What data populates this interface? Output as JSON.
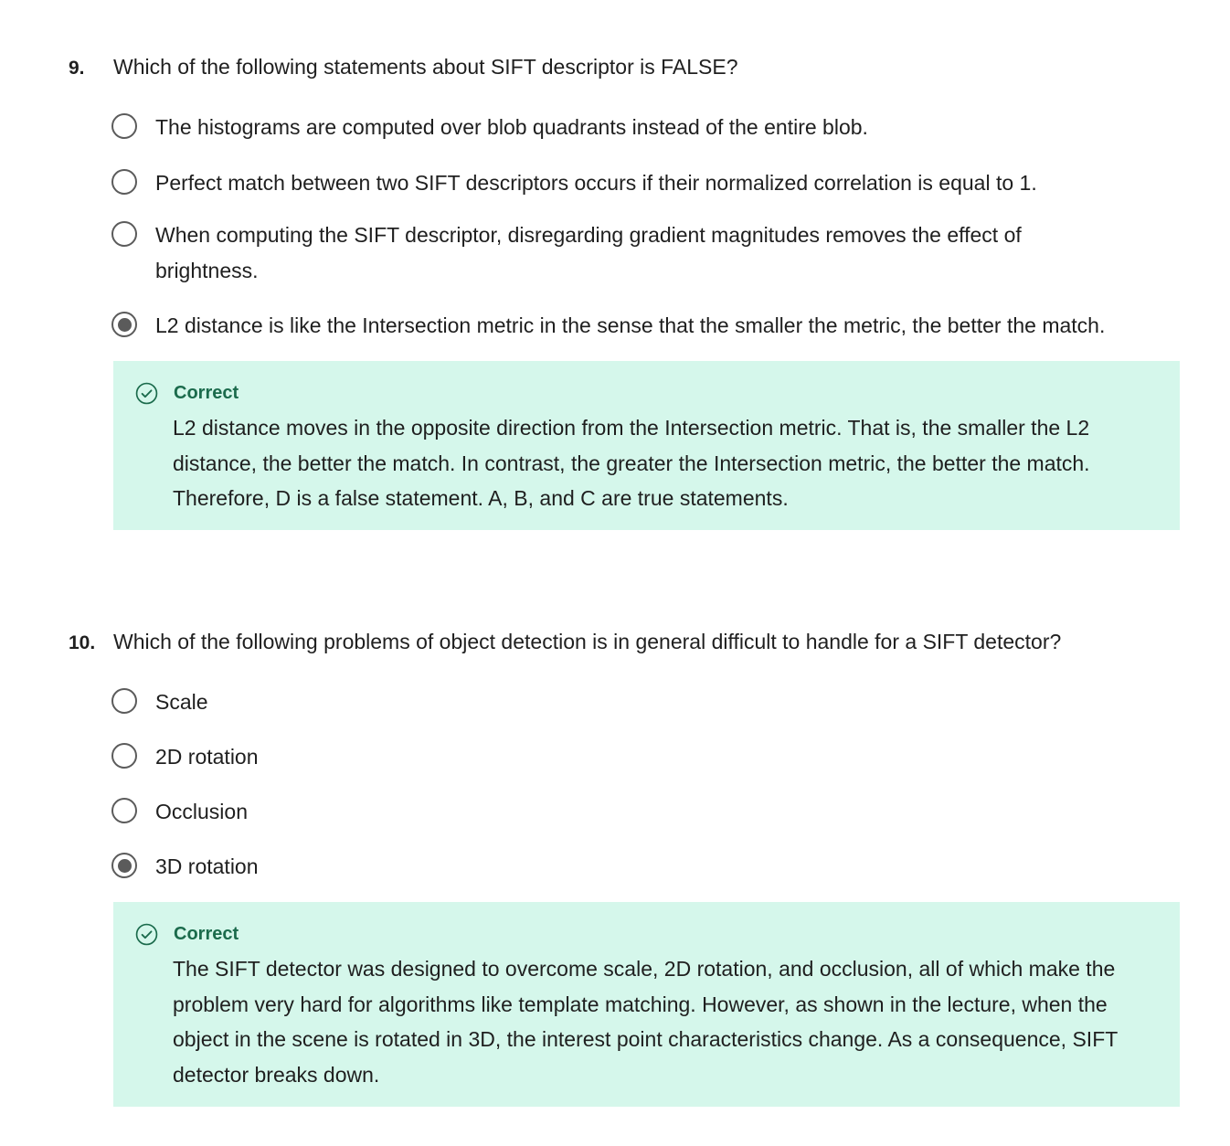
{
  "questions": [
    {
      "number": "9.",
      "text": "Which of the following statements about SIFT descriptor is FALSE?",
      "options": [
        {
          "label": "The histograms are computed over blob quadrants instead of the entire blob.",
          "selected": false
        },
        {
          "label": "Perfect match between two SIFT descriptors occurs if their normalized correlation is equal to 1.",
          "selected": false
        },
        {
          "label": "When computing the SIFT descriptor, disregarding gradient magnitudes removes the effect of brightness.",
          "selected": false
        },
        {
          "label": "L2 distance is like the Intersection metric in the sense that the smaller the metric, the better the match.",
          "selected": true
        }
      ],
      "feedback": {
        "status": "Correct",
        "text": "L2 distance moves in the opposite direction from the Intersection metric. That is, the smaller the L2 distance, the better the match. In contrast, the greater the Intersection metric, the better the match. Therefore, D is a false statement. A, B, and C are true statements."
      }
    },
    {
      "number": "10.",
      "text": "Which of the following problems of object detection is in general difficult to handle for a SIFT detector?",
      "options": [
        {
          "label": "Scale",
          "selected": false
        },
        {
          "label": "2D rotation",
          "selected": false
        },
        {
          "label": "Occlusion",
          "selected": false
        },
        {
          "label": "3D rotation",
          "selected": true
        }
      ],
      "feedback": {
        "status": "Correct",
        "text": "The SIFT detector was designed to overcome scale, 2D rotation, and occlusion, all of which make the problem very hard for algorithms like template matching. However, as shown in the lecture, when the object in the scene is rotated in 3D, the interest point characteristics change. As a consequence, SIFT detector breaks down."
      }
    }
  ],
  "colors": {
    "feedback_background": "#d5f7eb",
    "success_green": "#1b6b4c",
    "radio_gray": "#5b5b5b"
  },
  "icons": {
    "feedback_status": "check-circle-icon"
  }
}
